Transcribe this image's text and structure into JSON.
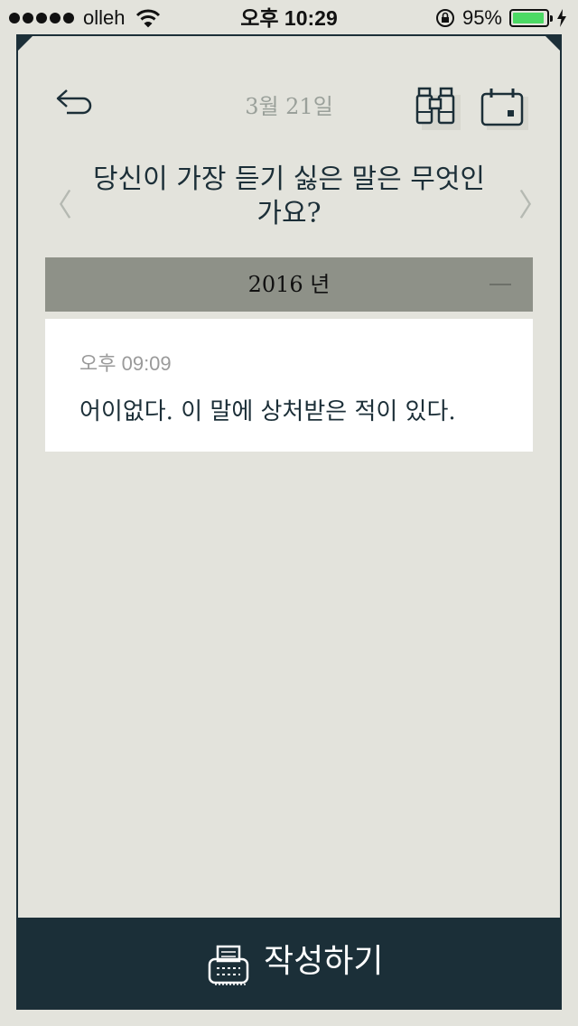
{
  "status_bar": {
    "carrier": "olleh",
    "time": "오후 10:29",
    "battery_percent": "95%",
    "battery_level": 0.95
  },
  "header": {
    "date": "3월 21일",
    "back_icon": "back-arrow-icon",
    "binoculars_icon": "binoculars-icon",
    "calendar_icon": "calendar-icon"
  },
  "question": {
    "text": "당신이 가장 듣기 싫은 말은 무엇인가요?",
    "prev": "〈",
    "next": "〉"
  },
  "year_section": {
    "label": "2016 년"
  },
  "entry": {
    "time": "오후 09:09",
    "text": "어이없다. 이 말에 상처받은 적이 있다."
  },
  "write_button": {
    "label": "작성하기",
    "icon": "typewriter-icon"
  },
  "colors": {
    "background": "#e3e3dc",
    "navy": "#1b2f38",
    "year_bar": "#8e9188",
    "battery_green": "#4cd964"
  }
}
